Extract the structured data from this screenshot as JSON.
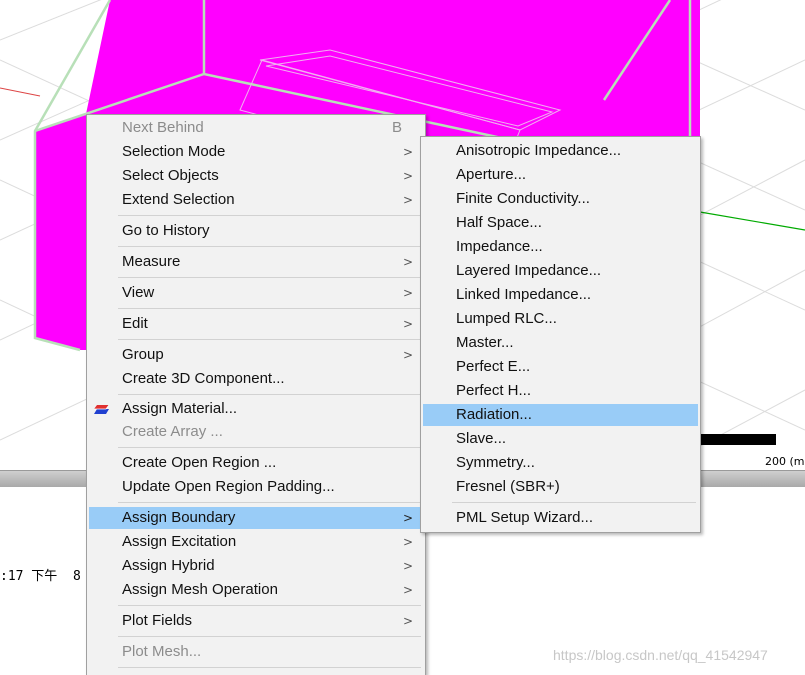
{
  "viewport": {
    "scale_label": "200 (m",
    "colors": {
      "object_fill": "#ff00ff",
      "edges": "#b8e0b8"
    }
  },
  "message_panel": {
    "text": ":17 下午  8",
    "watermark": "https://blog.csdn.net/qq_41542947"
  },
  "context_menu": {
    "items": [
      {
        "label": "Next Behind",
        "shortcut": "B"
      },
      {
        "label": "Selection Mode",
        "submenu": ">"
      },
      {
        "label": "Select Objects",
        "submenu": ">"
      },
      {
        "label": "Extend Selection",
        "submenu": ">"
      },
      {
        "label": "Go to History"
      },
      {
        "label": "Measure",
        "submenu": ">"
      },
      {
        "label": "View",
        "submenu": ">"
      },
      {
        "label": "Edit",
        "submenu": ">"
      },
      {
        "label": "Group",
        "submenu": ">"
      },
      {
        "label": "Create 3D Component..."
      },
      {
        "label": "Assign Material...",
        "icon": "material-icon"
      },
      {
        "label": "Create Array ..."
      },
      {
        "label": "Create Open Region ..."
      },
      {
        "label": "Update Open Region Padding..."
      },
      {
        "label": "Assign Boundary",
        "submenu": ">"
      },
      {
        "label": "Assign Excitation",
        "submenu": ">"
      },
      {
        "label": "Assign Hybrid",
        "submenu": ">"
      },
      {
        "label": "Assign Mesh Operation",
        "submenu": ">"
      },
      {
        "label": "Plot Fields",
        "submenu": ">"
      },
      {
        "label": "Plot Mesh..."
      }
    ]
  },
  "boundary_submenu": {
    "items": [
      {
        "label": "Anisotropic Impedance..."
      },
      {
        "label": "Aperture..."
      },
      {
        "label": "Finite Conductivity..."
      },
      {
        "label": "Half Space..."
      },
      {
        "label": "Impedance..."
      },
      {
        "label": "Layered Impedance..."
      },
      {
        "label": "Linked Impedance..."
      },
      {
        "label": "Lumped RLC..."
      },
      {
        "label": "Master..."
      },
      {
        "label": "Perfect E..."
      },
      {
        "label": "Perfect H..."
      },
      {
        "label": "Radiation..."
      },
      {
        "label": "Slave..."
      },
      {
        "label": "Symmetry..."
      },
      {
        "label": "Fresnel (SBR+)"
      },
      {
        "label": "PML Setup Wizard..."
      }
    ]
  },
  "colors": {
    "highlight": "#99ccf7",
    "menu_bg": "#f2f2f2",
    "disabled_text": "#8c8c8c"
  }
}
